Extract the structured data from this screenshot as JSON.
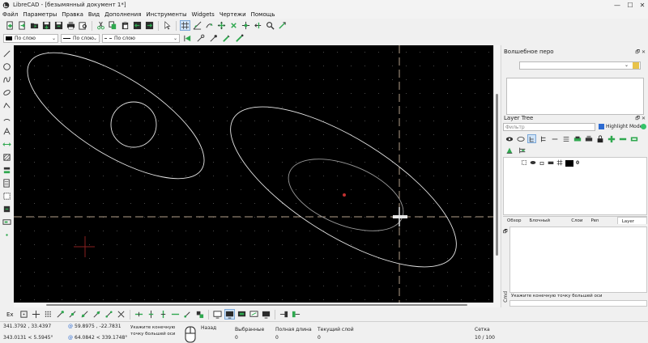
{
  "window": {
    "title": "LibreCAD - [безымянный документ 1*]",
    "controls": {
      "minimize": "—",
      "maximize": "☐",
      "close": "✕"
    }
  },
  "menu": [
    "Файл",
    "Параметры",
    "Правка",
    "Вид",
    "Дополнения",
    "Инструменты",
    "Widgets",
    "Чертежи",
    "Помощь"
  ],
  "pen_toolbar": {
    "color": "По слою",
    "width": "По слою",
    "linetype": "По слою"
  },
  "dock": {
    "pen_wizard_title": "Волшебное перо",
    "layer_tree_title": "Layer Tree",
    "filter_placeholder": "Фильтр",
    "highlight_mode": "Highlight Mode",
    "layer_name": "0",
    "tabs": [
      "Обзор",
      "Блочный список",
      "Слои",
      "Pen Palette",
      "Layer Tree"
    ],
    "active_tab": "Layer Tree",
    "cmd_label": "Cmd",
    "cmd_prompt": "Укажите конечную точку большей оси"
  },
  "snap": {
    "ex_label": "Ex"
  },
  "status": {
    "coord_abs": "341.3792 , 33.4397",
    "coord_polar": "343.0131 < 5.5945°",
    "coord_rel": "59.8975 , -22.7831",
    "coord_rel_polar": "64.0842 < 339.1748°",
    "prompt_line1": "Укажите конечную",
    "prompt_line2": "точку большей оси",
    "back": "Назад",
    "selected_label": "Выбранные",
    "selected_value": "0",
    "total_length_label": "Полная длина",
    "total_length_value": "0",
    "current_layer_label": "Текущий слой",
    "current_layer_value": "0",
    "grid_label": "Сетка",
    "grid_value": "10 / 100"
  },
  "colors": {
    "accent_green": "#2fa84f",
    "canvas_bg": "#000000",
    "entity": "#e6e6e6",
    "selection_blue": "#2d6bd1"
  }
}
